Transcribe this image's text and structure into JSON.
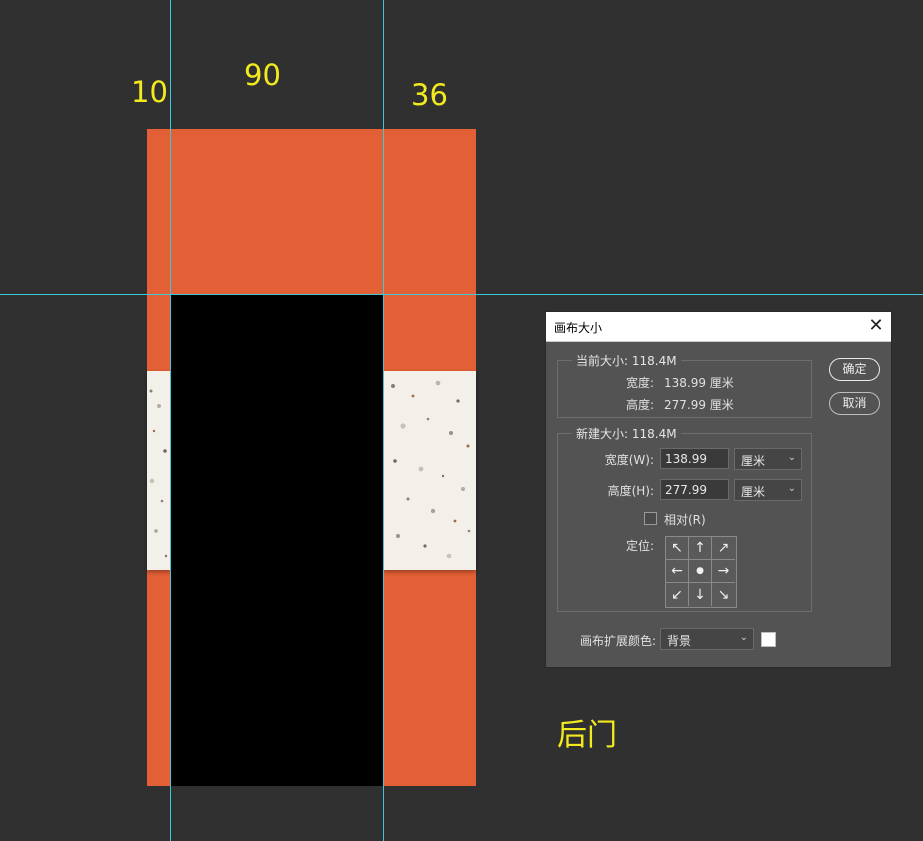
{
  "canvas": {
    "colors": {
      "background": "#303030",
      "orange": "#e35f35",
      "door": "#000000",
      "terrazzo": "#f3efe9",
      "guide": "#3cc8d6",
      "annotation": "#f2ea1e"
    },
    "dimension_labels": [
      "10",
      "90",
      "36"
    ],
    "caption": "后门"
  },
  "dialog": {
    "title": "画布大小",
    "close_icon": "close-icon",
    "current": {
      "legend": "当前大小: 118.4M",
      "width_label": "宽度:",
      "width_value": "138.99 厘米",
      "height_label": "高度:",
      "height_value": "277.99 厘米"
    },
    "new": {
      "legend": "新建大小: 118.4M",
      "width_label": "宽度(W):",
      "width_value": "138.99",
      "width_unit": "厘米",
      "height_label": "高度(H):",
      "height_value": "277.99",
      "height_unit": "厘米",
      "relative_label": "相对(R)",
      "relative_checked": false,
      "anchor_label": "定位:",
      "anchor_arrows": [
        "↖",
        "↑",
        "↗",
        "←",
        "●",
        "→",
        "↙",
        "↓",
        "↘"
      ]
    },
    "extension_color_label": "画布扩展颜色:",
    "extension_color_value": "背景",
    "extension_color_swatch": "#ffffff",
    "ok_label": "确定",
    "cancel_label": "取消"
  }
}
